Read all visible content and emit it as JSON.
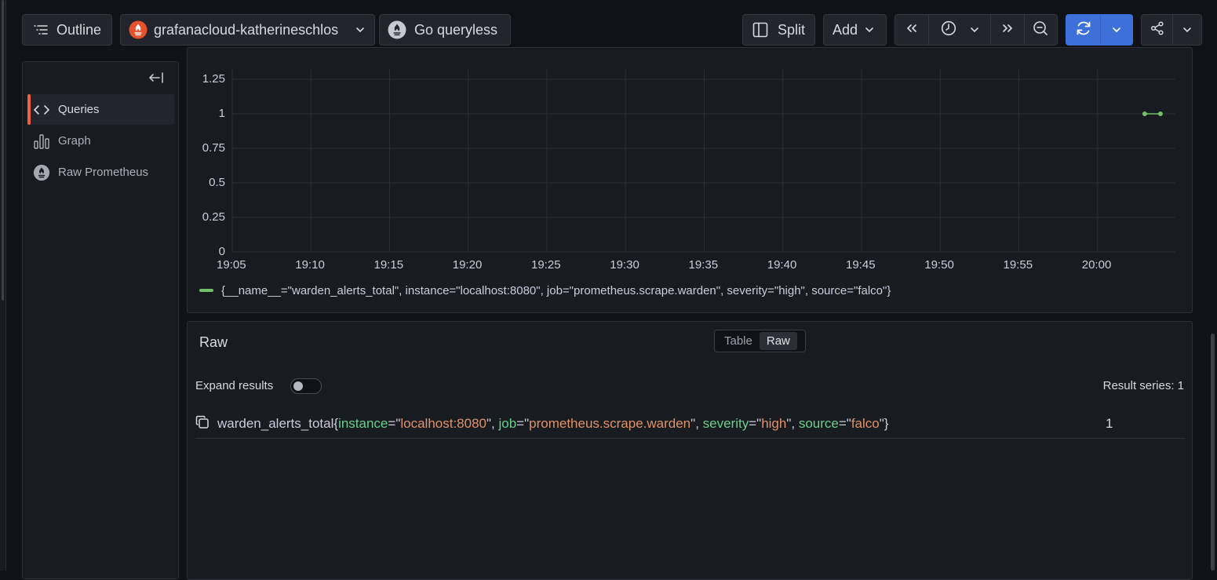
{
  "toolbar": {
    "outline_label": "Outline",
    "datasource_label": "grafanacloud-katherineschlos",
    "go_queryless_label": "Go queryless",
    "split_label": "Split",
    "add_label": "Add"
  },
  "sidebar": {
    "items": [
      {
        "label": "Queries",
        "active": true,
        "icon": "code-icon"
      },
      {
        "label": "Graph",
        "active": false,
        "icon": "bar-chart-icon"
      },
      {
        "label": "Raw Prometheus",
        "active": false,
        "icon": "prometheus-icon"
      }
    ]
  },
  "chart_data": {
    "type": "line",
    "x_tick_labels": [
      "19:05",
      "19:10",
      "19:15",
      "19:20",
      "19:25",
      "19:30",
      "19:35",
      "19:40",
      "19:45",
      "19:50",
      "19:55",
      "20:00"
    ],
    "y_tick_labels": [
      "0",
      "0.25",
      "0.5",
      "0.75",
      "1",
      "1.25"
    ],
    "ylim": [
      0,
      1.25
    ],
    "grid": true,
    "series": [
      {
        "name": "{__name__=\"warden_alerts_total\", instance=\"localhost:8080\", job=\"prometheus.scrape.warden\", severity=\"high\", source=\"falco\"}",
        "color": "#73bf69",
        "points": [
          {
            "x": "20:03",
            "y": 1
          },
          {
            "x": "20:04",
            "y": 1
          }
        ]
      }
    ],
    "legend_position": "bottom-left"
  },
  "raw": {
    "title": "Raw",
    "view_options": [
      "Table",
      "Raw"
    ],
    "selected_view": "Raw",
    "expand_label": "Expand results",
    "expand_on": false,
    "result_count_label": "Result series: 1",
    "row": {
      "metric": "warden_alerts_total",
      "labels": [
        {
          "key": "instance",
          "value": "localhost:8080"
        },
        {
          "key": "job",
          "value": "prometheus.scrape.warden"
        },
        {
          "key": "severity",
          "value": "high"
        },
        {
          "key": "source",
          "value": "falco"
        }
      ],
      "value": "1"
    }
  },
  "colors": {
    "accent": "#3d71d9",
    "series": "#73bf69",
    "label_key": "#6ccf8e",
    "label_value": "#e0926a",
    "active_bar": "#f55f3e"
  }
}
